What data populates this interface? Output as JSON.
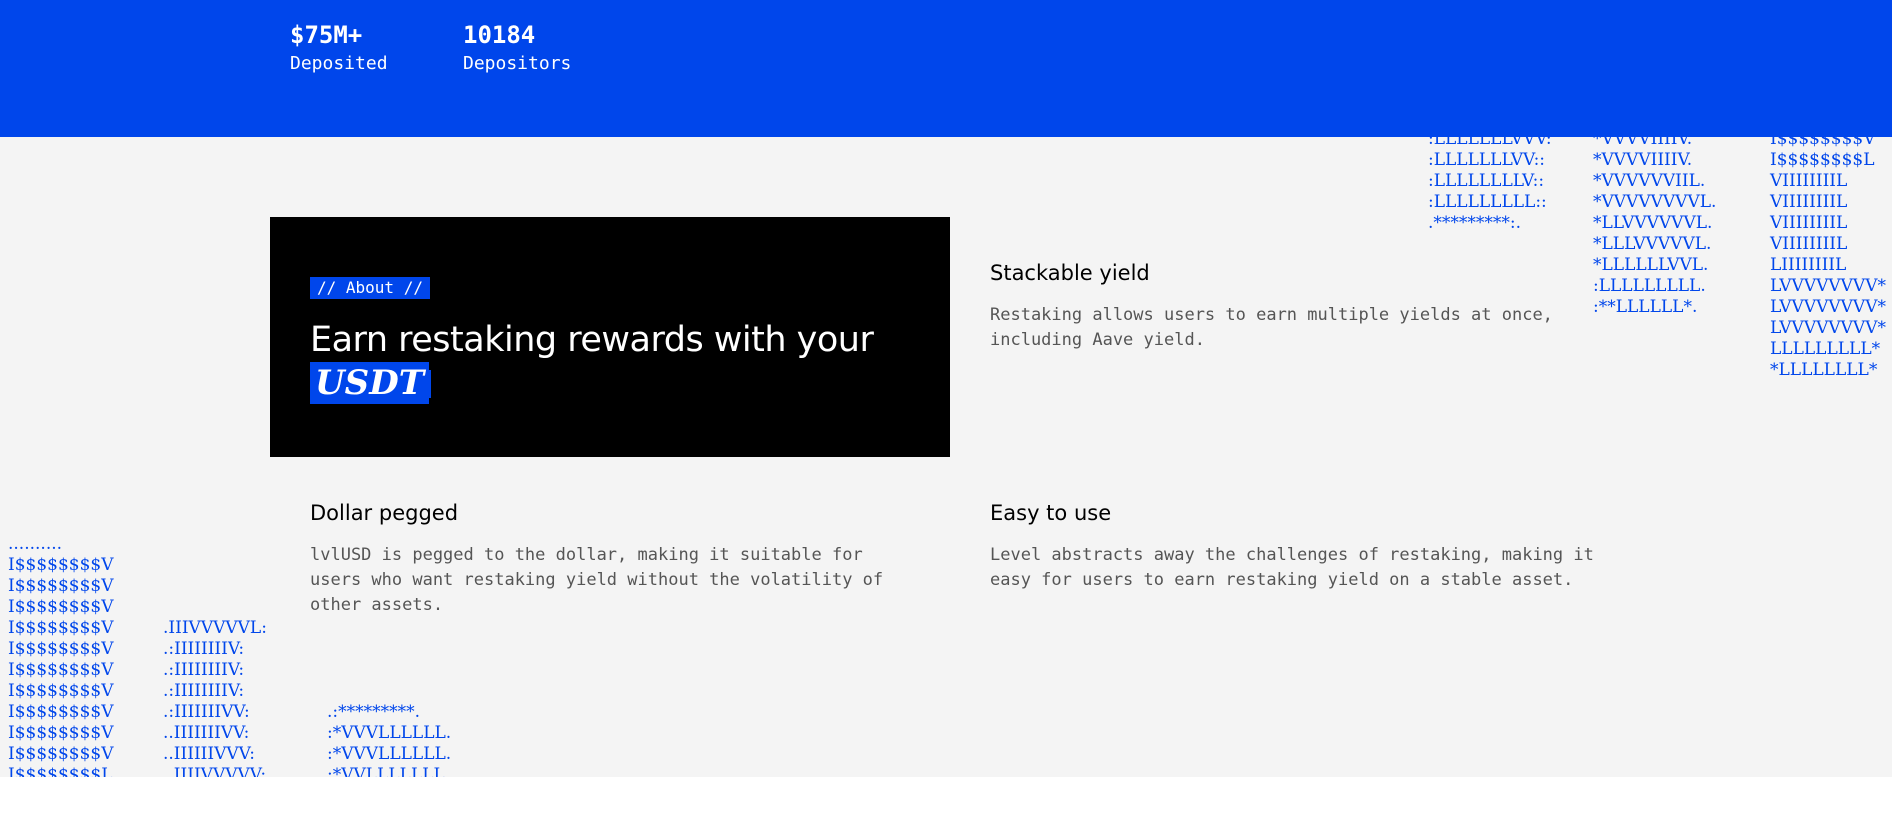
{
  "stats": {
    "deposited": {
      "value": "$75M+",
      "label": "Deposited"
    },
    "depositors": {
      "value": "10184",
      "label": "Depositors"
    }
  },
  "about": {
    "tag": "// About //",
    "headline": "Earn restaking rewards with your",
    "highlight": "USDT"
  },
  "features": {
    "stackable": {
      "title": "Stackable yield",
      "body": "Restaking allows users to earn multiple yields at once, including Aave yield."
    },
    "dollar": {
      "title": "Dollar pegged",
      "body": "lvlUSD is pegged to the dollar, making it suitable for users who want restaking yield without the volatility of other assets."
    },
    "easy": {
      "title": "Easy to use",
      "body": "Level abstracts away the challenges of restaking, making it easy for users to earn restaking yield on a stable asset."
    }
  },
  "ascii_art": {
    "top_left_col": ":LLLLLLLVVV:\n:LLLLLLLVV::\n:LLLLLLLLV::\n:LLLLLLLLL::\n.*********:.",
    "top_mid_col": "*VVVVIIIIV.\n*VVVVIIIIV.\n*VVVVVVIIL.\n*VVVVVVVVL.\n*LLVVVVVVL.\n*LLLVVVVVL.\n*LLLLLLVVL.\n:LLLLLLLLL.\n:**LLLLLL*.",
    "top_right_col": "I$$$$$$$$V\nI$$$$$$$$L\nVIIIIIIIIL\nVIIIIIIIIL\nVIIIIIIIIL\nVIIIIIIIIL\nLIIIIIIIIL\nLVVVVVVVV*\nLVVVVVVVV*\nLVVVVVVVV*\nLLLLLLLLL*\n*LLLLLLLL*",
    "bottom_left_col": "..........\nI$$$$$$$$V\nI$$$$$$$$V\nI$$$$$$$$V\nI$$$$$$$$V\nI$$$$$$$$V\nI$$$$$$$$V\nI$$$$$$$$V\nI$$$$$$$$V\nI$$$$$$$$V\nI$$$$$$$$V\nI$$$$$$$$L",
    "bottom_mid_col": ".IIIVVVVVL:\n.:IIIIIIIIV:\n.:IIIIIIIIV:\n.:IIIIIIIIV:\n.:IIIIIIIVV:\n..IIIIIIIVV:\n..IIIIIIVVV:\n..IIIIVVVVV:",
    "bottom_right_col": ".:*********.\n:*VVVLLLLLL.\n:*VVVLLLLLL.\n:*VVLLLLLLL."
  }
}
